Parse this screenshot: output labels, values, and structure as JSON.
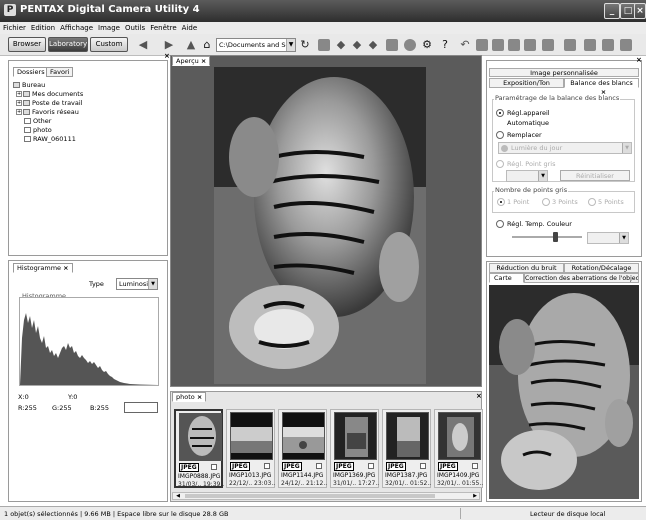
{
  "app": {
    "title": "PENTAX Digital Camera Utility 4"
  },
  "menu": [
    "Fichier",
    "Edition",
    "Affichage",
    "Image",
    "Outils",
    "Fenêtre",
    "Aide"
  ],
  "toolbar": {
    "browser": "Browser",
    "laboratory": "Laboratory",
    "custom": "Custom",
    "path": "C:\\Documents and Setting"
  },
  "folders": {
    "tabs": [
      "Dossiers",
      "Favori"
    ],
    "tree": [
      {
        "label": "Bureau",
        "level": 0
      },
      {
        "label": "Mes documents",
        "level": 1
      },
      {
        "label": "Poste de travail",
        "level": 1
      },
      {
        "label": "Favoris réseau",
        "level": 1
      },
      {
        "label": "Other",
        "level": 1
      },
      {
        "label": "photo",
        "level": 1
      },
      {
        "label": "RAW_060111",
        "level": 1
      }
    ]
  },
  "histogram": {
    "tab": "Histogramme",
    "type_label": "Type",
    "type_value": "Luminosité",
    "group_label": "Histogramme",
    "x": "X:0",
    "y": "Y:0",
    "r": "R:255",
    "g": "G:255",
    "b": "B:255"
  },
  "preview": {
    "tab": "Aperçu"
  },
  "browser": {
    "tab": "photo",
    "thumbs": [
      {
        "format": "JPEG",
        "name": "IMGP0888.JPG",
        "date": "31/03/..  19:39.."
      },
      {
        "format": "JPEG",
        "name": "IMGP1013.JPG",
        "date": "22/12/..  23:03.."
      },
      {
        "format": "JPEG",
        "name": "IMGP1144.JPG",
        "date": "24/12/..  21:12.."
      },
      {
        "format": "JPEG",
        "name": "IMGP1369.JPG",
        "date": "31/01/..  17:27.."
      },
      {
        "format": "JPEG",
        "name": "IMGP1387.JPG",
        "date": "32/01/..  01:52.."
      },
      {
        "format": "JPEG",
        "name": "IMGP1409.JPG",
        "date": "32/01/..  01:55.."
      }
    ]
  },
  "settings": {
    "title": "Image personnalisée",
    "tabs": [
      "Exposition/Ton",
      "Balance des blancs"
    ],
    "group": "Paramétrage de la balance des blancs",
    "opt_camera": "Régl.appareil",
    "auto": "Automatique",
    "opt_replace": "Remplacer",
    "daylight": "Lumière du jour",
    "opt_gray": "Régl. Point gris",
    "reinit": "Réinitialiser",
    "points_group": "Nombre de points gris",
    "p1": "1 Point",
    "p3": "3 Points",
    "p5": "5 Points",
    "opt_temp": "Régl. Temp. Couleur",
    "slider_value": 0.62
  },
  "lower_right": {
    "tabs_top": [
      "Réduction du bruit",
      "Rotation/Décalage"
    ],
    "tabs_bottom": [
      "Carte",
      "Correction des aberrations de l'objectif"
    ]
  },
  "status": {
    "left": "1 objet(s) sélectionnés | 9.66 MB | Espace libre sur le disque 28.8 GB",
    "right": "Lecteur de disque local"
  }
}
